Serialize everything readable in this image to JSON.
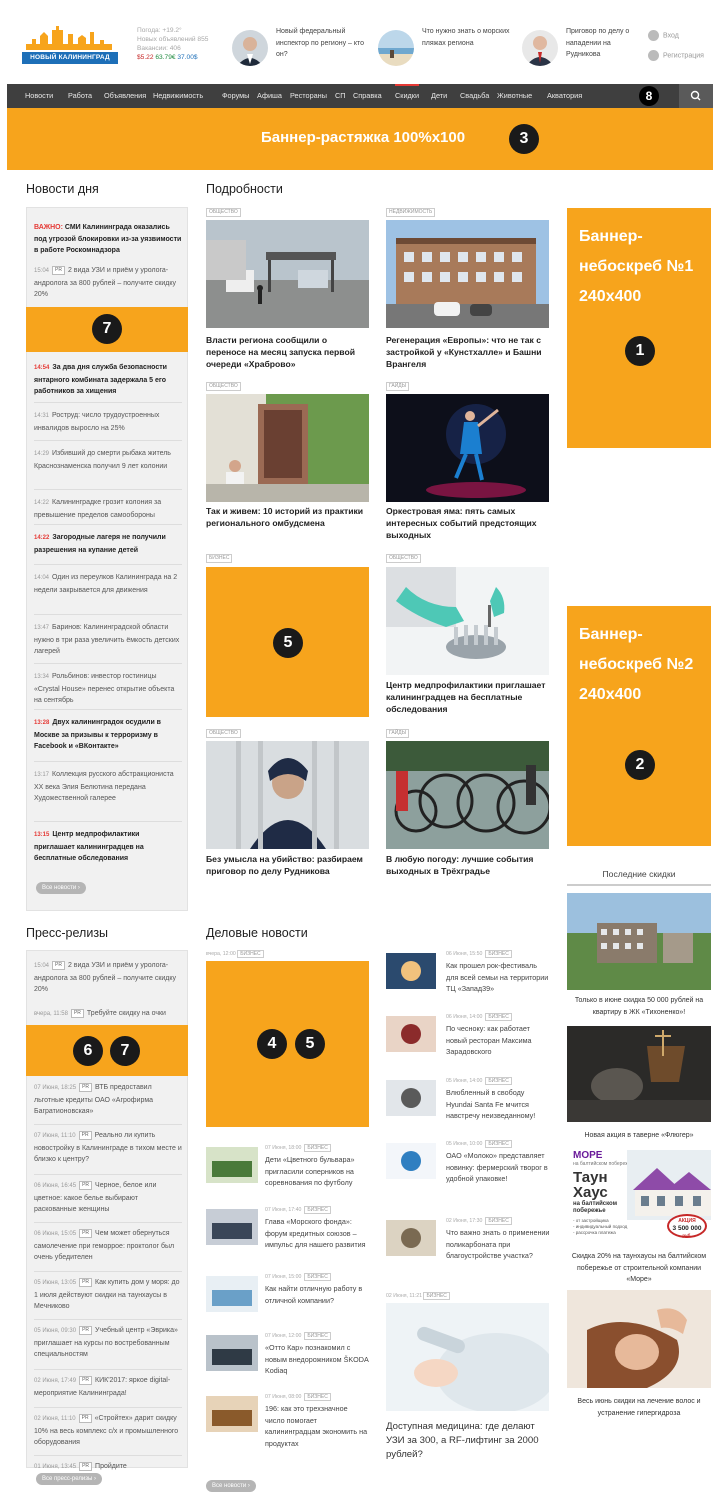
{
  "header": {
    "logo_text": "НОВЫЙ КАЛИНИНГРАД",
    "weather": "Погода: +19.2°",
    "new_ads": "Новых объявлений 855",
    "vacancies": "Вакансии: 406",
    "fx_usd": "$5.22",
    "fx_eur": "63.79€",
    "fx_rub": "37.00$",
    "teasers": [
      "Новый федеральный инспектор по региону – кто он?",
      "Что нужно знать о морских пляжах региона",
      "Приговор по делу о нападении на Рудникова"
    ],
    "login": "Вход",
    "register": "Регистрация"
  },
  "nav": {
    "items": [
      "Новости",
      "Работа",
      "Объявления",
      "Недвижимость",
      "Форумы",
      "Афиша",
      "Рестораны",
      "СП",
      "Справка",
      "Скидки",
      "Дети",
      "Свадьба",
      "Животные",
      "Акватория"
    ],
    "badge": "8",
    "search_icon": "search-icon"
  },
  "banners": {
    "top": "Баннер-растяжка 100%x100",
    "top_num": "3",
    "sky1_l1": "Баннер-",
    "sky1_l2": "небоскреб №1",
    "sky1_l3": "240x400",
    "sky1_num": "1",
    "sky2_l1": "Баннер-",
    "sky2_l2": "небоскреб №2",
    "sky2_l3": "240x400",
    "sky2_num": "2",
    "left_num": "7",
    "mid_num": "5",
    "press_num1": "6",
    "press_num2": "7",
    "biz_num1": "4",
    "biz_num2": "5"
  },
  "news_day": {
    "title": "Новости дня",
    "important_label": "ВАЖНО:",
    "important": "СМИ Калининграда оказались под угрозой блокировки из-за уязвимости в работе Роскомнадзора",
    "item1_time": "15:04",
    "item1_tag": "PR",
    "item1": "2 вида УЗИ и приём у уролога-андролога за 800 рублей – получите скидку 20%",
    "items": [
      {
        "time": "14:54",
        "text": "За два дня служба безопасности янтарного комбината задержала 5 его работников за хищения",
        "bold": true
      },
      {
        "time": "14:31",
        "text": "Роструд: число трудоустроенных инвалидов выросло на 25%",
        "bold": false
      },
      {
        "time": "14:29",
        "text": "Избивший до смерти рыбака житель Краснознаменска получил 9 лет колонии",
        "bold": false
      },
      {
        "time": "14:22",
        "text": "Калининградке грозит колония за превышение пределов самообороны",
        "bold": false
      },
      {
        "time": "14:22",
        "text": "Загородные лагеря не получили разрешения на купание детей",
        "bold": true
      },
      {
        "time": "14:04",
        "text": "Один из переулков Калининграда на 2 недели закрывается для движения",
        "bold": false
      },
      {
        "time": "13:47",
        "text": "Баринов: Калининградской области нужно в три раза увеличить ёмкость детских лагерей",
        "bold": false
      },
      {
        "time": "13:34",
        "text": "Рольбинов: инвестор гостиницы «Crystal House» перенес открытие объекта на сентябрь",
        "bold": false
      },
      {
        "time": "13:28",
        "text": "Двух калининградок осудили в Москве за призывы к терроризму в Facebook и «ВКонтакте»",
        "bold": true
      },
      {
        "time": "13:17",
        "text": "Коллекция русского абстракциониста XX века Элия Белютина передана Художественной галерее",
        "bold": false
      },
      {
        "time": "13:15",
        "text": "Центр медпрофилактики приглашает калининградцев на бесплатные обследования",
        "bold": true
      }
    ],
    "more": "Все новости"
  },
  "details": {
    "title": "Подробности",
    "cards": [
      {
        "tag": "ОБЩЕСТВО",
        "title": "Власти региона сообщили о переносе на месяц запуска первой очереди «Храброво»"
      },
      {
        "tag": "НЕДВИЖИМОСТЬ",
        "title": "Регенерация «Европы»: что не так с застройкой у «Кунстхалле» и Башни Врангеля"
      },
      {
        "tag": "ОБЩЕСТВО",
        "title": "Так и живем: 10 историй из практики регионального омбудсмена"
      },
      {
        "tag": "ГАЙДЫ",
        "title": "Оркестровая яма: пять самых интересных событий предстоящих выходных"
      },
      {
        "tag": "БИЗНЕС",
        "title": ""
      },
      {
        "tag": "ОБЩЕСТВО",
        "title": "Центр медпрофилактики приглашает калининградцев на бесплатные обследования"
      },
      {
        "tag": "ОБЩЕСТВО",
        "title": "Без умысла на убийство: разбираем приговор по делу Рудникова"
      },
      {
        "tag": "ГАЙДЫ",
        "title": "В любую погоду: лучшие события выходных в Трёхградье"
      }
    ]
  },
  "discounts": {
    "title": "Последние скидки",
    "items": [
      "Только в июне скидка 50 000 рублей на квартиру в ЖК «Тихоненко»!",
      "Новая акция в таверне «Флюгер»",
      "Скидка 20% на таунхаусы на балтийском побережье от строительной компании «Море»",
      "Весь июнь скидки на лечение волос и устранение гипергидроза"
    ],
    "ad_brand": "МОРЕ",
    "ad_brand_sub": "на балтийском побережье",
    "ad_title1": "Таун",
    "ad_title2": "Хаус",
    "ad_sub1": "на балтийском",
    "ad_sub2": "побережье",
    "ad_b1": "- от застройщика",
    "ad_b2": "- индивидуальный подход",
    "ad_b3": "- рассрочка платежа",
    "ad_badge1": "АКЦИЯ",
    "ad_badge2": "3 500 000",
    "ad_badge3": "руб."
  },
  "press": {
    "title": "Пресс-релизы",
    "first_time": "15:04",
    "first": "2 вида УЗИ и приём у уролога-андролога за 800 рублей – получите скидку 20%",
    "second_time": "вчера, 11:58",
    "second": "Требуйте скидку на очки",
    "items": [
      {
        "time": "07 Июня, 18:25",
        "text": "ВТБ предоставил льготные кредиты ОАО «Агрофирма Багратионовская»"
      },
      {
        "time": "07 Июня, 11:10",
        "text": "Реально ли купить новостройку в Калининграде в тихом месте и близко к центру?"
      },
      {
        "time": "06 Июня, 16:45",
        "text": "Черное, белое или цветное: какое белье выбирают раскованные женщины"
      },
      {
        "time": "06 Июня, 15:05",
        "text": "Чем может обернуться самолечение при геморрое: проктолог был очень убедителен"
      },
      {
        "time": "05 Июня, 13:05",
        "text": "Как купить дом у моря: до 1 июля действуют скидки на таунхаусы в Мечниково"
      },
      {
        "time": "05 Июня, 09:30",
        "text": "Учебный центр «Эврика» приглашает на курсы по востребованным специальностям"
      },
      {
        "time": "02 Июня, 17:49",
        "text": "КИК'2017: яркое digital-мероприятие Калининграда!"
      },
      {
        "time": "02 Июня, 11:10",
        "text": "«Стройтех» дарит скидку 10% на весь комплекс с/х и промышленного оборудования"
      },
      {
        "time": "01 Июня, 13:45",
        "text": "Пройдите"
      }
    ],
    "more": "Все пресс-релизы"
  },
  "business": {
    "title": "Деловые новости",
    "first_meta": "вчера, 12:00",
    "tag": "БИЗНЕС",
    "left_items": [
      {
        "time": "07 Июня, 18:00",
        "text": "Дети «Цветного бульвара» пригласили соперников на соревнования по футболу"
      },
      {
        "time": "07 Июня, 17:40",
        "text": "Глава «Морского фонда»: форум кредитных союзов – импульс для нашего развития"
      },
      {
        "time": "07 Июня, 15:00",
        "text": "Как найти отличную работу в отличной компании?"
      },
      {
        "time": "07 Июня, 12:00",
        "text": "«Отто Кар» познакомил с новым внедорожником ŠKODA Kodiaq"
      },
      {
        "time": "07 Июня, 08:00",
        "text": "196: как это трехзначное число помогает калининградцам экономить на продуктах"
      }
    ],
    "right_items": [
      {
        "time": "06 Июня, 15:50",
        "text": "Как прошел рок-фестиваль для всей семьи на территории ТЦ «Запад39»"
      },
      {
        "time": "06 Июня, 14:00",
        "text": "По чесноку: как работает новый ресторан Максима Зарадовского"
      },
      {
        "time": "05 Июня, 14:00",
        "text": "Влюбленный в свободу Hyundai Santa Fe мчится навстречу неизведанному!"
      },
      {
        "time": "05 Июня, 10:00",
        "text": "ОАО «Молоко» представляет новинку: фермерский творог в удобной упаковке!"
      },
      {
        "time": "02 Июня, 17:30",
        "text": "Что важно знать о применении поликарбоната при благоустройстве участка?"
      }
    ],
    "big_time": "02 Июня, 11:21",
    "big_title": "Доступная медицина: где делают УЗИ за 300, а RF-лифтинг за 2000 рублей?",
    "more": "Все новости"
  }
}
